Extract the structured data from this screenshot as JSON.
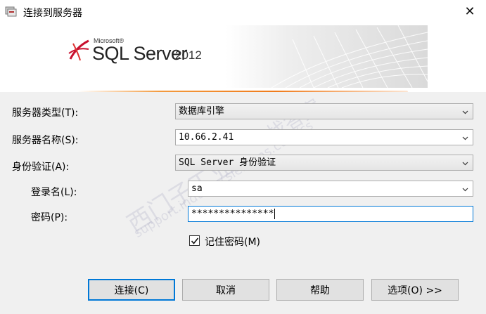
{
  "window": {
    "title": "连接到服务器",
    "close_glyph": "✕"
  },
  "banner": {
    "brand_small": "Microsoft®",
    "product": "SQL Server",
    "year": "2012"
  },
  "form": {
    "server_type": {
      "label": "服务器类型(T):",
      "value": "数据库引擎"
    },
    "server_name": {
      "label": "服务器名称(S):",
      "value": "10.66.2.41"
    },
    "auth": {
      "label": "身份验证(A):",
      "value": "SQL Server 身份验证"
    },
    "login": {
      "label": "登录名(L):",
      "value": "sa"
    },
    "password": {
      "label": "密码(P):",
      "value": "***************"
    },
    "remember": {
      "label": "记住密码(M)",
      "checked": true
    }
  },
  "buttons": {
    "connect": "连接(C)",
    "cancel": "取消",
    "help": "帮助",
    "options": "选项(O) >>"
  },
  "watermark": {
    "line1": "西门子工业",
    "line2": "support.industry.siemens.com/cs",
    "line3": "找答案"
  }
}
